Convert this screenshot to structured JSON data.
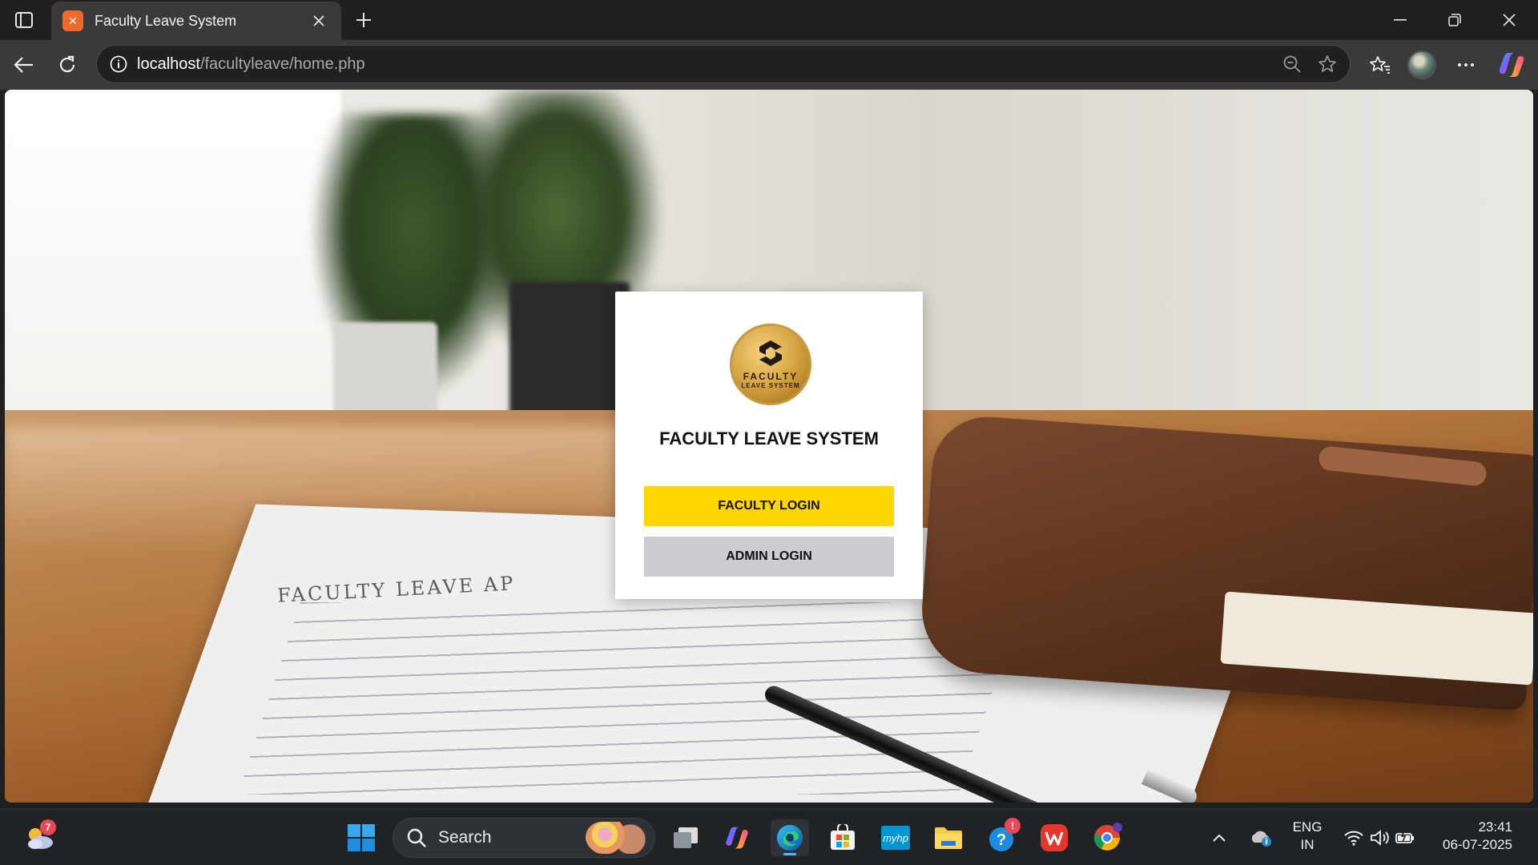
{
  "browser": {
    "tab": {
      "title": "Faculty Leave System",
      "favicon_letter": "✕"
    },
    "address": {
      "host": "localhost",
      "path": "/facultyleave/home.php"
    }
  },
  "page": {
    "background_heading": "FACULTY LEAVE AP",
    "logo": {
      "line1": "FACULTY",
      "line2": "LEAVE SYSTEM"
    },
    "title": "FACULTY LEAVE SYSTEM",
    "buttons": {
      "faculty": "FACULTY LOGIN",
      "admin": "ADMIN LOGIN"
    },
    "colors": {
      "faculty_button": "#ffd500",
      "admin_button": "#cccdd0",
      "card": "#ffffff"
    }
  },
  "taskbar": {
    "weather_badge": "7",
    "search_label": "Search",
    "help_badge": "!",
    "tray": {
      "lang_line1": "ENG",
      "lang_line2": "IN",
      "time": "23:41",
      "date": "06-07-2025"
    },
    "apps": [
      "start",
      "search",
      "task-view",
      "copilot",
      "edge",
      "store",
      "myhp",
      "file-explorer",
      "get-help",
      "wps-office",
      "chrome"
    ]
  }
}
